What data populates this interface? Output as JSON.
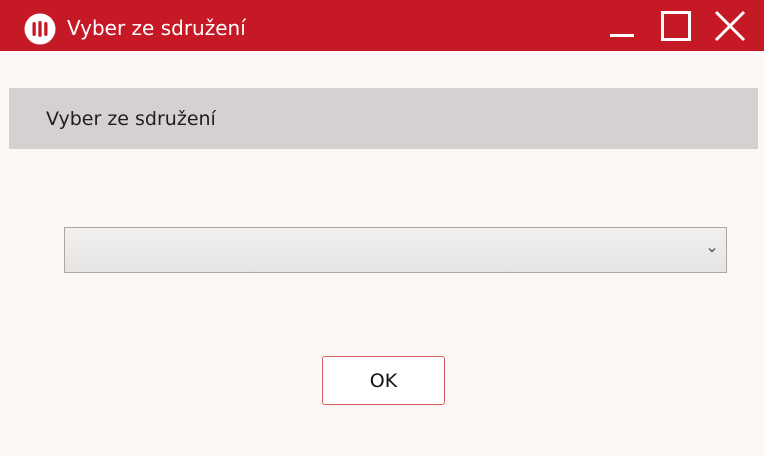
{
  "window": {
    "title": "Vyber ze sdružení",
    "accent_color": "#c51a26",
    "logo_icon": "app-logo-icon",
    "controls": {
      "minimize_icon": "minimize-icon",
      "maximize_icon": "maximize-icon",
      "close_icon": "close-icon"
    }
  },
  "dialog": {
    "header_label": "Vyber ze sdružení",
    "select": {
      "value": "",
      "arrow_icon": "chevron-down-icon"
    },
    "ok_label": "OK"
  }
}
